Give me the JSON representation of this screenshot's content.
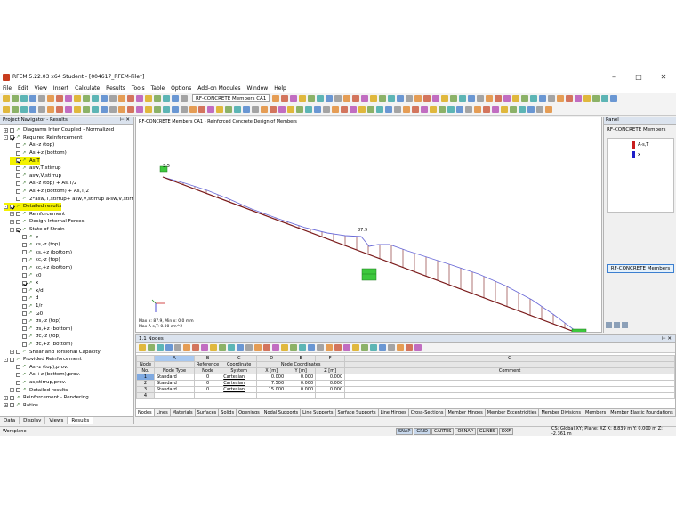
{
  "window": {
    "title": "RFEM 5.22.03 x64 Student - [004617_RFEM-File*]"
  },
  "menu": [
    "File",
    "Edit",
    "View",
    "Insert",
    "Calculate",
    "Results",
    "Tools",
    "Table",
    "Options",
    "Add-on Modules",
    "Window",
    "Help"
  ],
  "toolbar": {
    "module_combo": "RF-CONCRETE Members CA1"
  },
  "navigator": {
    "title": "Project Navigator - Results",
    "items": [
      {
        "label": "Diagrams Inter Coupled - Normalized",
        "level": 0,
        "exp": "+",
        "cb": false
      },
      {
        "label": "Required Reinforcement",
        "level": 0,
        "exp": "-",
        "cb": true
      },
      {
        "label": "As,-z (top)",
        "level": 1,
        "cb": false
      },
      {
        "label": "As,+z (bottom)",
        "level": 1,
        "cb": false
      },
      {
        "label": "As,T",
        "level": 1,
        "cb": true,
        "hl": true
      },
      {
        "label": "asw,T,stirrup",
        "level": 1,
        "cb": false
      },
      {
        "label": "asw,V,stirrup",
        "level": 1,
        "cb": false
      },
      {
        "label": "As,-z (top) + As,T/2",
        "level": 1,
        "cb": false
      },
      {
        "label": "As,+z (bottom) + As,T/2",
        "level": 1,
        "cb": false
      },
      {
        "label": "2*asw,T,stirrup+ asw,V,stirrup a-sw,V,stirrup",
        "level": 1,
        "cb": false
      },
      {
        "label": "Detailed results",
        "level": 0,
        "exp": "-",
        "cb": true,
        "hl": true
      },
      {
        "label": "Reinforcement",
        "level": 1,
        "exp": "+",
        "cb": false
      },
      {
        "label": "Design Internal Forces",
        "level": 1,
        "exp": "+",
        "cb": false
      },
      {
        "label": "State of Strain",
        "level": 1,
        "exp": "-",
        "cb": true
      },
      {
        "label": "z",
        "level": 2,
        "cb": false
      },
      {
        "label": "εs,-z (top)",
        "level": 2,
        "cb": false
      },
      {
        "label": "εs,+z (bottom)",
        "level": 2,
        "cb": false
      },
      {
        "label": "εc,-z (top)",
        "level": 2,
        "cb": false
      },
      {
        "label": "εc,+z (bottom)",
        "level": 2,
        "cb": false
      },
      {
        "label": "ε0",
        "level": 2,
        "cb": false
      },
      {
        "label": "x",
        "level": 2,
        "cb": true
      },
      {
        "label": "x/d",
        "level": 2,
        "cb": false
      },
      {
        "label": "d",
        "level": 2,
        "cb": false
      },
      {
        "label": "1/r",
        "level": 2,
        "cb": false
      },
      {
        "label": "ω0",
        "level": 2,
        "cb": false
      },
      {
        "label": "σs,-z (top)",
        "level": 2,
        "cb": false
      },
      {
        "label": "σs,+z (bottom)",
        "level": 2,
        "cb": false
      },
      {
        "label": "σc,-z (top)",
        "level": 2,
        "cb": false
      },
      {
        "label": "σc,+z (bottom)",
        "level": 2,
        "cb": false
      },
      {
        "label": "Shear and Torsional Capacity",
        "level": 1,
        "exp": "+",
        "cb": false
      },
      {
        "label": "Provided Reinforcement",
        "level": 0,
        "exp": "-",
        "cb": false
      },
      {
        "label": "As,-z (top),prov.",
        "level": 1,
        "cb": false
      },
      {
        "label": "As,+z (bottom),prov.",
        "level": 1,
        "cb": false
      },
      {
        "label": "as,stirrup,prov.",
        "level": 1,
        "cb": false
      },
      {
        "label": "Detailed results",
        "level": 1,
        "exp": "+",
        "cb": false
      },
      {
        "label": "Reinforcement - Rendering",
        "level": 0,
        "exp": "+",
        "cb": false
      },
      {
        "label": "Ratios",
        "level": 0,
        "exp": "+",
        "cb": false
      }
    ],
    "tabs": [
      "Data",
      "Display",
      "Views",
      "Results"
    ]
  },
  "view": {
    "caption": "RF-CONCRETE Members CA1 - Reinforced Concrete Design of Members",
    "label_left": "3.5",
    "label_mid": "87.9",
    "minmax_1": "Max x: 87.9, Min x: 0.0 mm",
    "minmax_2": "Max A-s,T: 0.00 cm^2"
  },
  "panel": {
    "title": "Panel",
    "subtitle": "RF-CONCRETE Members",
    "legend": [
      {
        "label": "A-s,T",
        "color": "#c81e1e"
      },
      {
        "label": "x",
        "color": "#1e1ec8"
      }
    ],
    "button": "RF-CONCRETE Members"
  },
  "table": {
    "title": "1.1 Nodes",
    "col_letters": [
      "A",
      "B",
      "C",
      "D",
      "E",
      "F",
      "G"
    ],
    "head1": {
      "node": "Node",
      "ref": "Reference",
      "coord": "Coordinate",
      "coords": "Node Coordinates",
      "comment": ""
    },
    "head2": {
      "no": "No.",
      "type": "Node Type",
      "ref": "Node",
      "sys": "System",
      "x": "X [m]",
      "y": "Y [m]",
      "z": "Z [m]",
      "comment": "Comment"
    },
    "rows": [
      {
        "no": "1",
        "type": "Standard",
        "ref": "0",
        "sys": "Cartesian",
        "x": "0.000",
        "y": "0.000",
        "z": "0.000"
      },
      {
        "no": "2",
        "type": "Standard",
        "ref": "0",
        "sys": "Cartesian",
        "x": "7.500",
        "y": "0.000",
        "z": "0.000"
      },
      {
        "no": "3",
        "type": "Standard",
        "ref": "0",
        "sys": "Cartesian",
        "x": "15.000",
        "y": "0.000",
        "z": "0.000"
      },
      {
        "no": "4",
        "type": "",
        "ref": "",
        "sys": "",
        "x": "",
        "y": "",
        "z": ""
      }
    ],
    "sheets": [
      "Nodes",
      "Lines",
      "Materials",
      "Surfaces",
      "Solids",
      "Openings",
      "Nodal Supports",
      "Line Supports",
      "Surface Supports",
      "Line Hinges",
      "Cross-Sections",
      "Member Hinges",
      "Member Eccentricities",
      "Member Divisions",
      "Members",
      "Member Elastic Foundations"
    ]
  },
  "status": {
    "left": "Workplane",
    "buttons": [
      "SNAP",
      "GRID",
      "CARTES",
      "OSNAP",
      "GLINES",
      "DXF"
    ],
    "right": "CS: Global XY; Plane: XZ     X: 8.839 m   Y: 0.000 m   Z: -2.361 m"
  }
}
